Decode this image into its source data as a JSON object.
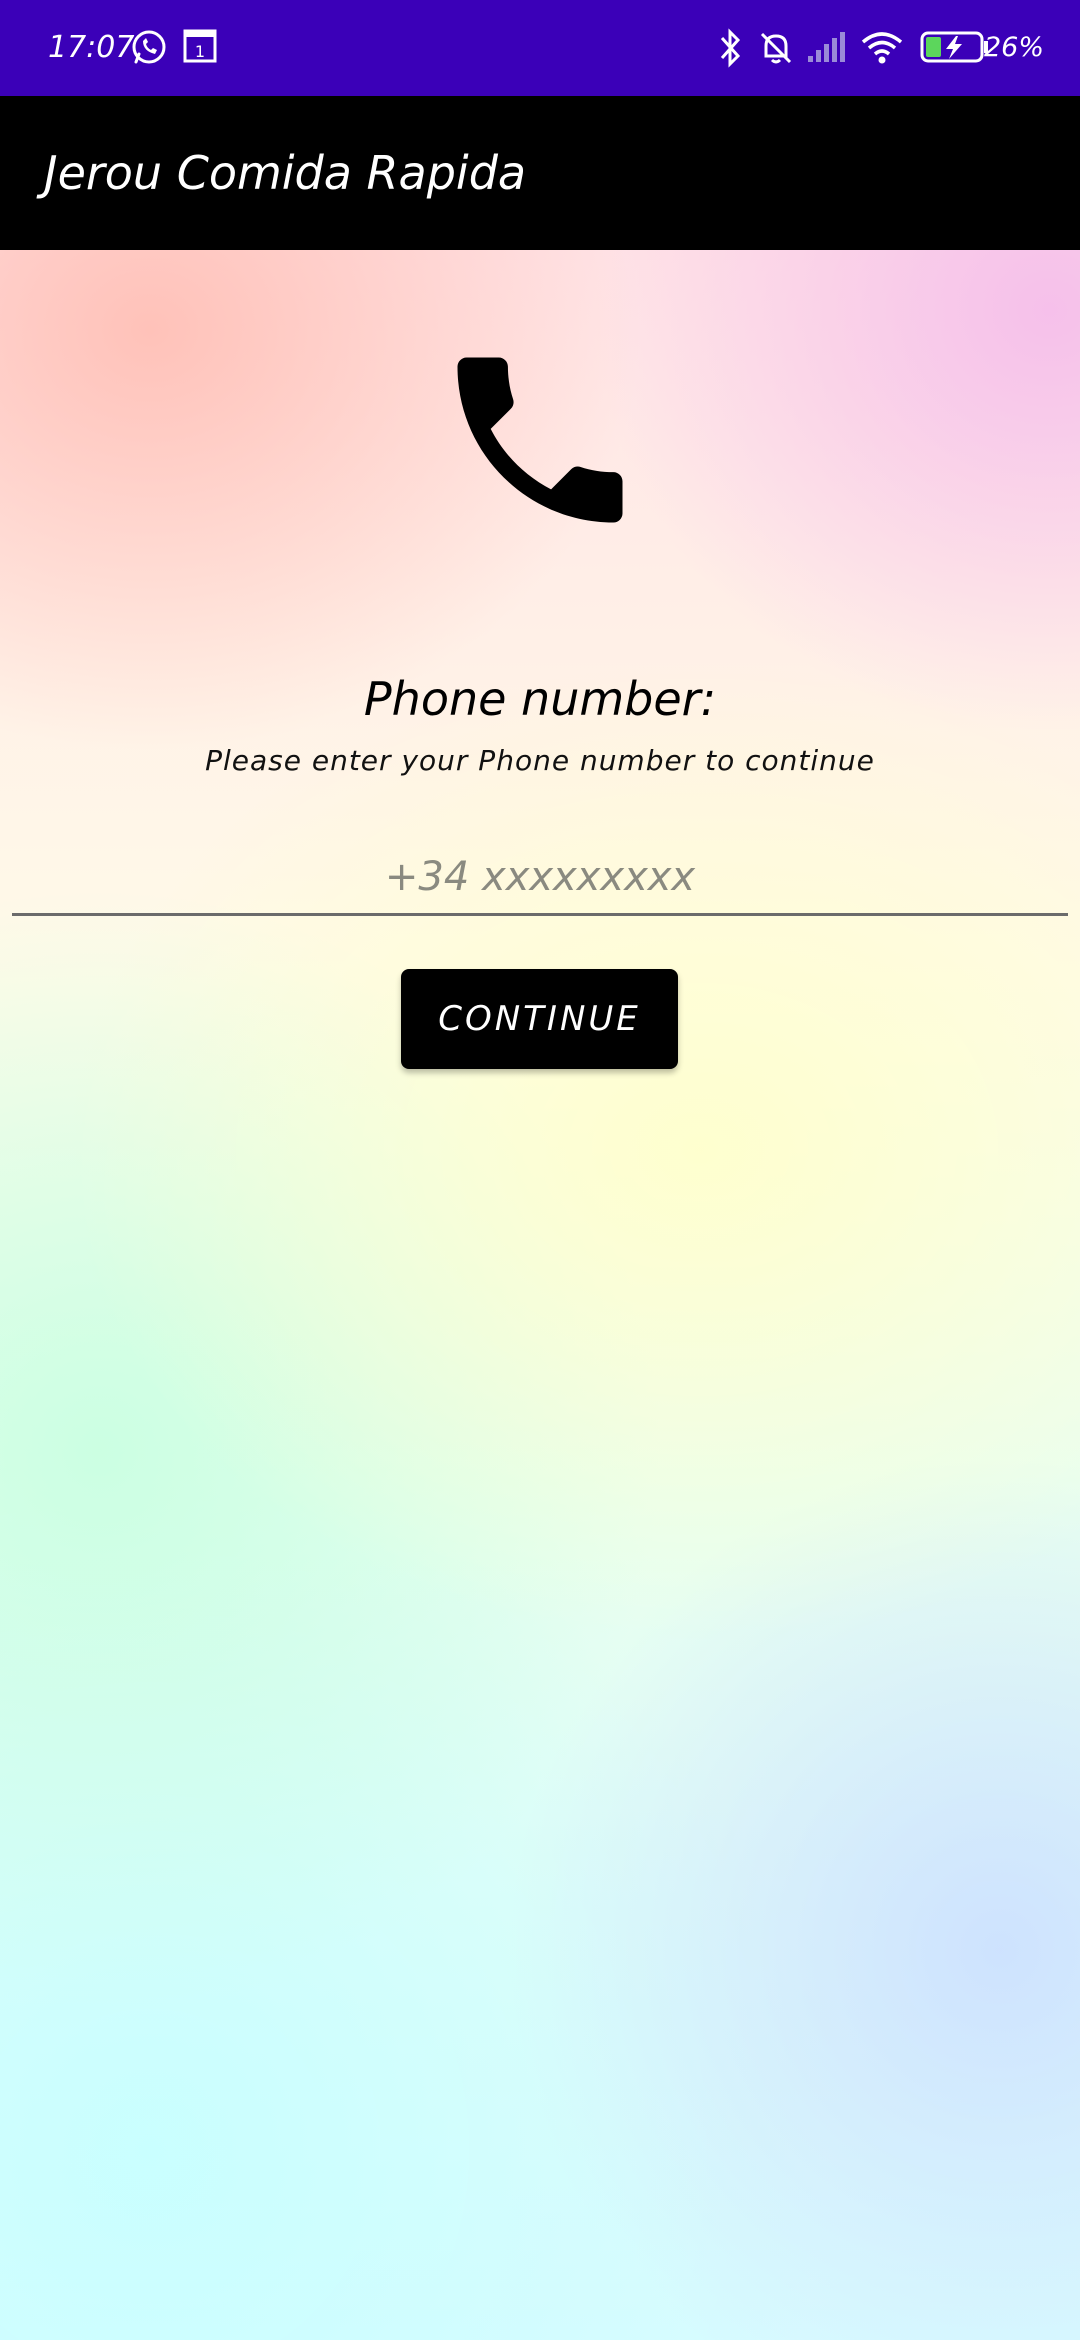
{
  "status_bar": {
    "time": "17:07",
    "battery": "26%",
    "icons": [
      "whatsapp-icon",
      "calendar-icon",
      "bluetooth-icon",
      "mute-icon",
      "signal-icon",
      "wifi-icon",
      "battery-charging-icon"
    ],
    "calendar_day": "1",
    "background_color": "#3b00b8"
  },
  "app_bar": {
    "title": "Jerou Comida Rapida",
    "background_color": "#000000"
  },
  "main": {
    "icon": "phone-icon",
    "heading": "Phone number:",
    "subheading": "Please enter your Phone number to continue",
    "phone_input": {
      "placeholder": "+34 xxxxxxxxx",
      "value": ""
    },
    "continue_label": "CONTINUE"
  }
}
